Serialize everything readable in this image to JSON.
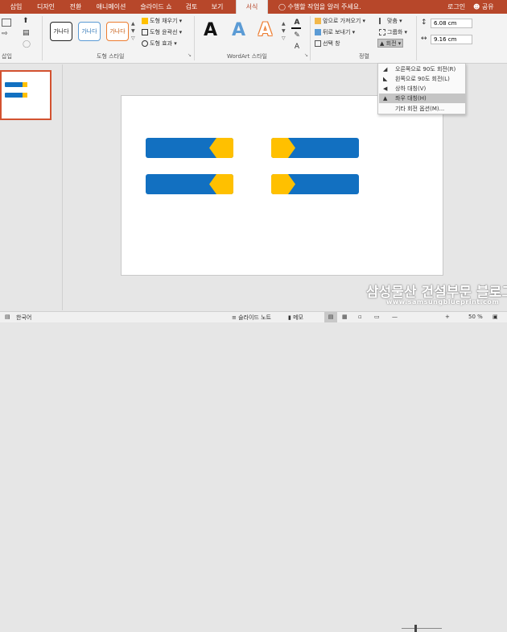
{
  "tabs": [
    "삽입",
    "디자인",
    "전환",
    "애니메이션",
    "슬라이드 쇼",
    "검토",
    "보기",
    "서식"
  ],
  "active_tab": "서식",
  "tellme": "수행할 작업을 알려 주세요.",
  "signin": "로그인",
  "share": "공유",
  "ribbon": {
    "group_insert": "삽입",
    "group_shape_styles": "도형 스타일",
    "group_wordart": "WordArt 스타일",
    "group_arrange": "정렬",
    "style_sample": "가나다",
    "shape_fill": "도형 채우기",
    "shape_outline": "도형 윤곽선",
    "shape_effects": "도형 효과",
    "wordart_letter": "A",
    "bring_forward": "앞으로 가져오기",
    "send_backward": "뒤로 보내기",
    "selection_pane": "선택 창",
    "align": "맞춤",
    "group": "그룹화",
    "rotate": "회전",
    "height": "6.08 cm",
    "width": "9.16 cm"
  },
  "rotate_menu": [
    "오른쪽으로 90도 회전(R)",
    "왼쪽으로 90도 회전(L)",
    "상하 대칭(V)",
    "좌우 대칭(H)",
    "기타 회전 옵션(M)..."
  ],
  "status": {
    "language": "한국어",
    "notes": "슬라이드 노트",
    "comments": "메모",
    "zoom": "50 %"
  },
  "watermark": {
    "title": "삼성물산 건설부문 블로그",
    "url": "www.samsungblueprint.com"
  },
  "colors": {
    "accent": "#b7472a",
    "bar_blue": "#1270c1",
    "cap_yellow": "#ffc000"
  }
}
